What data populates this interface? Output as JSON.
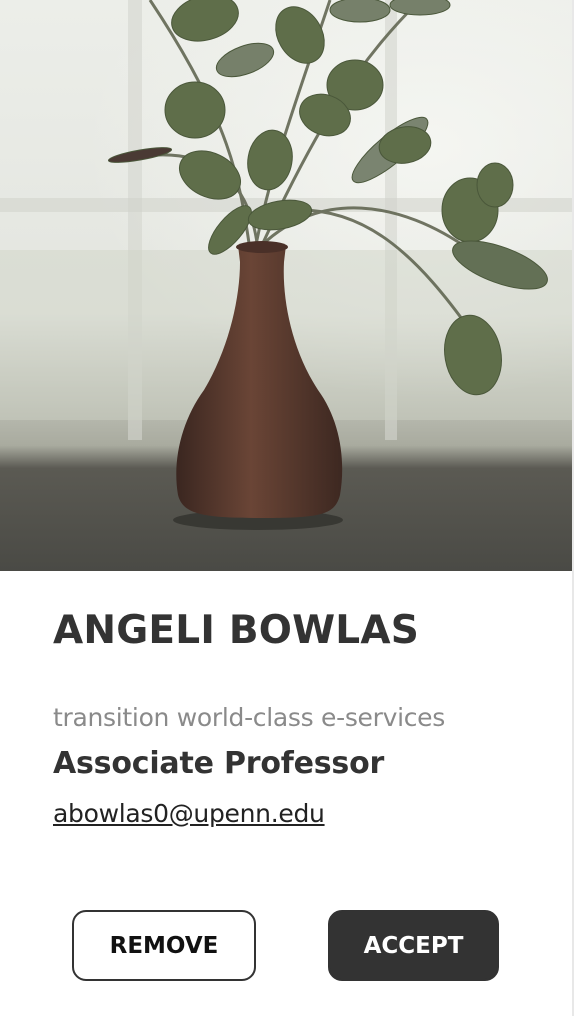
{
  "profile": {
    "name": "ANGELI BOWLAS",
    "tagline": "transition world-class e-services",
    "position": "Associate Professor",
    "email": "abowlas0@upenn.edu"
  },
  "actions": {
    "remove_label": "REMOVE",
    "accept_label": "ACCEPT"
  },
  "colors": {
    "primary": "#333333",
    "secondary_text": "#8a8a8a",
    "background": "#ffffff"
  }
}
